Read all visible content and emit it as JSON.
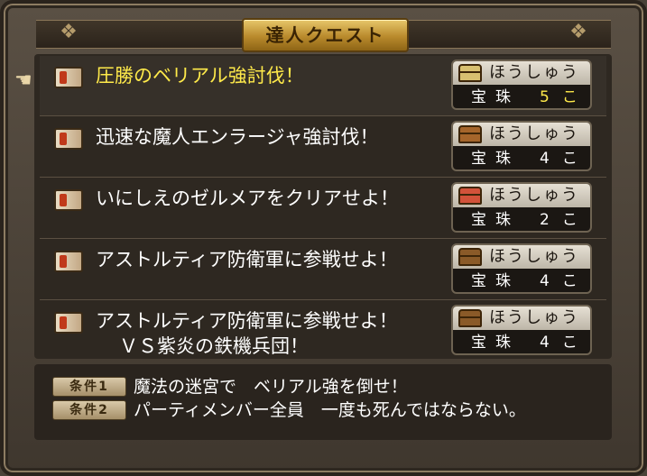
{
  "window": {
    "title": "達人クエスト"
  },
  "quests": [
    {
      "title": "圧勝のベリアル強討伐！",
      "subtitle": "",
      "reward_label": "ほうしゅう",
      "reward_item": "宝珠",
      "reward_qty": "5こ",
      "selected": true,
      "chest_color": "#d8c070"
    },
    {
      "title": "迅速な魔人エンラージャ強討伐！",
      "subtitle": "",
      "reward_label": "ほうしゅう",
      "reward_item": "宝珠",
      "reward_qty": "4こ",
      "selected": false,
      "chest_color": "#a5652b"
    },
    {
      "title": "いにしえのゼルメアをクリアせよ！",
      "subtitle": "",
      "reward_label": "ほうしゅう",
      "reward_item": "宝珠",
      "reward_qty": "2こ",
      "selected": false,
      "chest_color": "#d2523a"
    },
    {
      "title": "アストルティア防衛軍に参戦せよ！",
      "subtitle": "",
      "reward_label": "ほうしゅう",
      "reward_item": "宝珠",
      "reward_qty": "4こ",
      "selected": false,
      "chest_color": "#8a5a28"
    },
    {
      "title": "アストルティア防衛軍に参戦せよ！",
      "subtitle": "ＶＳ紫炎の鉄機兵団！",
      "reward_label": "ほうしゅう",
      "reward_item": "宝珠",
      "reward_qty": "4こ",
      "selected": false,
      "chest_color": "#8a5a28"
    }
  ],
  "conditions": [
    {
      "badge": "条件1",
      "text": "魔法の迷宮で　ベリアル強を倒せ！"
    },
    {
      "badge": "条件2",
      "text": "パーティメンバー全員　一度も死んではならない。"
    }
  ],
  "colors": {
    "highlight": "#ffea4a",
    "text": "#ffffff"
  }
}
